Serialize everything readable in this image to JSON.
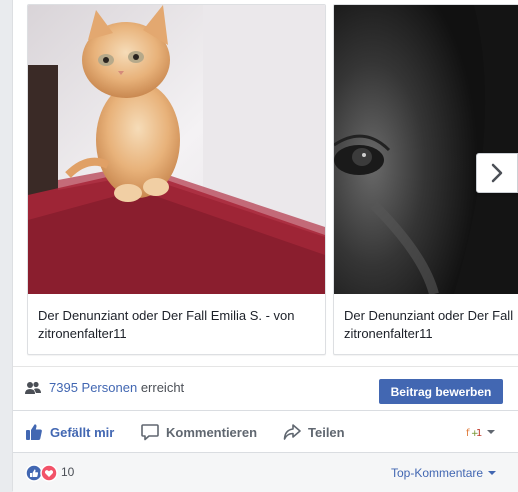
{
  "carousel": {
    "cards": [
      {
        "caption_line1": "Der Denunziant oder Der Fall Emilia S. - von",
        "caption_line2": "zitronenfalter11",
        "image": "kitten-photo"
      },
      {
        "caption_line1": "Der Denunziant oder Der Fall",
        "caption_line2": "zitronenfalter11",
        "image": "eye-closeup-photo"
      }
    ],
    "next_icon": "chevron-right-icon"
  },
  "reach": {
    "count": "7395 Personen",
    "suffix": "erreicht",
    "boost_label": "Beitrag bewerben",
    "icon": "people-icon"
  },
  "actions": {
    "like": "Gefällt mir",
    "comment": "Kommentieren",
    "share": "Teilen",
    "share_as_icon": "page-avatar-icon"
  },
  "reactions": {
    "count": "10",
    "icons": [
      "like-reaction-icon",
      "love-reaction-icon"
    ],
    "sort_label": "Top-Kommentare"
  },
  "colors": {
    "accent": "#4267b2",
    "love": "#f25268",
    "background": "#e9ebee"
  }
}
